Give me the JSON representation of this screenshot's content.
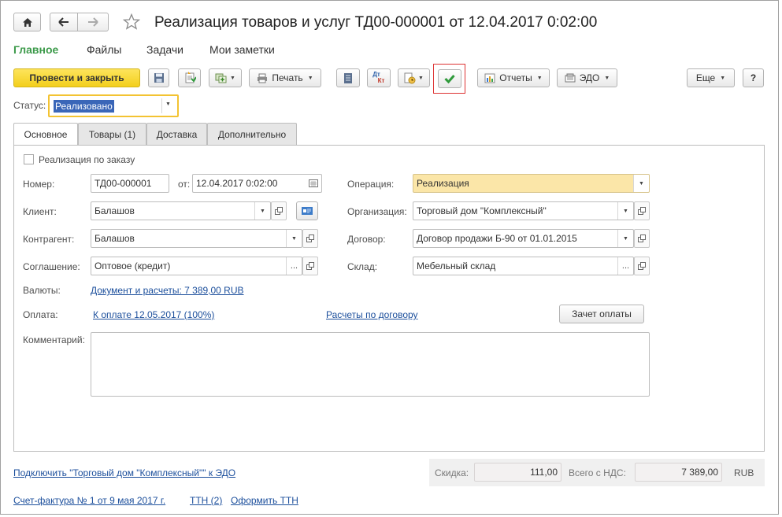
{
  "header": {
    "title": "Реализация товаров и услуг ТД00-000001 от 12.04.2017 0:02:00"
  },
  "menu": [
    "Главное",
    "Файлы",
    "Задачи",
    "Мои заметки"
  ],
  "toolbar": {
    "post_close": "Провести и закрыть",
    "print": "Печать",
    "reports": "Отчеты",
    "edo": "ЭДО",
    "more": "Еще",
    "help": "?",
    "dtkt_top": "Дт",
    "dtkt_bottom": "Кт"
  },
  "status": {
    "label": "Статус:",
    "value": "Реализовано"
  },
  "tabs": [
    "Основное",
    "Товары (1)",
    "Доставка",
    "Дополнительно"
  ],
  "form": {
    "by_order_label": "Реализация по заказу",
    "number_label": "Номер:",
    "number_value": "ТД00-000001",
    "from_label": "от:",
    "date_value": "12.04.2017  0:02:00",
    "client_label": "Клиент:",
    "client_value": "Балашов",
    "counterparty_label": "Контрагент:",
    "counterparty_value": "Балашов",
    "agreement_label": "Соглашение:",
    "agreement_value": "Оптовое (кредит)",
    "currency_label": "Валюты:",
    "currency_link": "Документ и расчеты: 7 389,00 RUB",
    "payment_label": "Оплата:",
    "payment_link": "К оплате 12.05.2017 (100%)",
    "contract_calc_link": "Расчеты по договору",
    "offset_button": "Зачет оплаты",
    "comment_label": "Комментарий:",
    "operation_label": "Операция:",
    "operation_value": "Реализация",
    "organization_label": "Организация:",
    "organization_value": "Торговый дом \"Комплексный\"",
    "contract_label": "Договор:",
    "contract_value": "Договор продажи Б-90 от 01.01.2015",
    "warehouse_label": "Склад:",
    "warehouse_value": "Мебельный склад",
    "ellipsis": "..."
  },
  "footer": {
    "edo_link": "Подключить \"Торговый дом \"Комплексный\"\" к ЭДО",
    "discount_label": "Скидка:",
    "discount_value": "111,00",
    "total_label": "Всего с НДС:",
    "total_value": "7 389,00",
    "currency": "RUB",
    "invoice_link": "Счет-фактура № 1 от 9 мая 2017 г.",
    "ttn_link": "ТТН (2)",
    "make_ttn_link": "Оформить ТТН"
  },
  "colors": {
    "accent_green": "#3c9a4a",
    "primary_button": "#f5d52b",
    "link": "#1c4f9c",
    "operation_highlight": "#fbe6a8"
  }
}
